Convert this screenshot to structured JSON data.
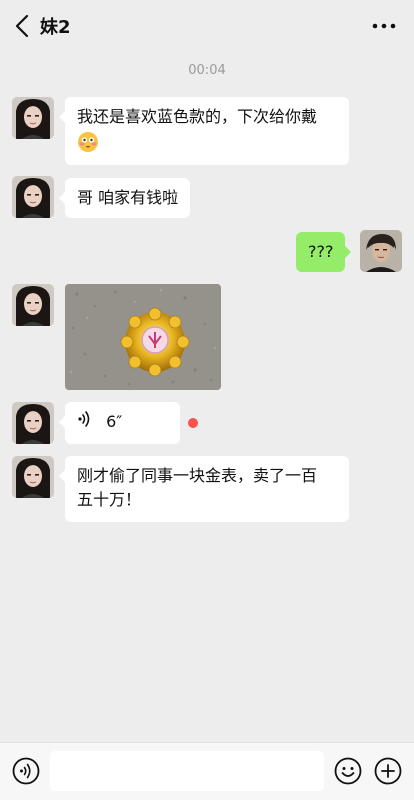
{
  "header": {
    "title": "妹2",
    "back_icon": "chevron-left-icon",
    "more_icon": "more-dots-icon"
  },
  "chat": {
    "timestamp": "00:04",
    "messages": [
      {
        "sender": "left",
        "type": "text",
        "text": "我还是喜欢蓝色款的，下次给你戴",
        "emoji": "flushed-face-emoji"
      },
      {
        "sender": "left",
        "type": "text",
        "text": "哥 咱家有钱啦"
      },
      {
        "sender": "right",
        "type": "text",
        "text": "???"
      },
      {
        "sender": "left",
        "type": "image",
        "image": "gold-watch-photo"
      },
      {
        "sender": "left",
        "type": "voice",
        "duration": "6″",
        "unread": true
      },
      {
        "sender": "left",
        "type": "text",
        "text_line1": "刚才偷了同事一块金表，卖了一百",
        "text_line2": "五十万！"
      }
    ]
  },
  "input_bar": {
    "voice_icon": "voice-mode-icon",
    "emoji_icon": "smiley-icon",
    "plus_icon": "plus-icon",
    "text_value": ""
  },
  "colors": {
    "background": "#ededed",
    "bubble_left": "#ffffff",
    "bubble_right": "#95ec69",
    "unread_dot": "#fa5151"
  }
}
